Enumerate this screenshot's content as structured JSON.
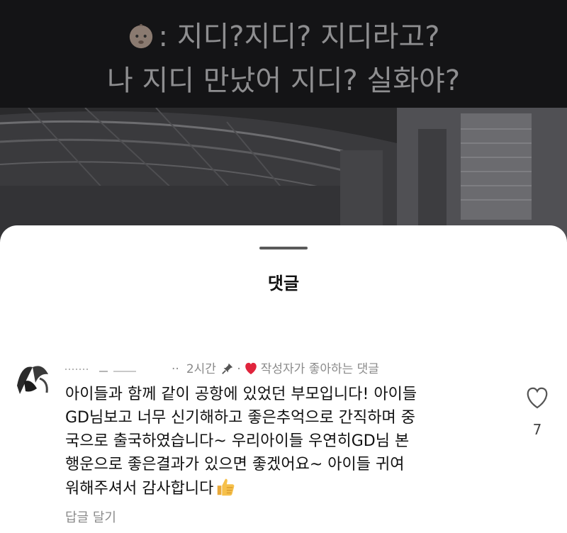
{
  "video": {
    "caption_line1": ": 지디?지디? 지디라고?",
    "caption_line2": "나 지디 만났어 지디? 실화야?",
    "caption_emoji": "baby-face-icon"
  },
  "sheet": {
    "title": "댓글"
  },
  "comment": {
    "time": "2시간",
    "creator_liked": "작성자가 좋아하는 댓글",
    "lines": [
      "아이들과 함께 같이 공항에 있었던 부모입니다! 아이들",
      "GD님보고 너무 신기해하고 좋은추억으로 간직하며 중",
      "국으로 출국하였습니다~ 우리아이들 우연히GD님 본",
      "행운으로 좋은결과가 있으면 좋겠어요~ 아이들 귀여",
      "워해주셔서 감사합니다"
    ],
    "like_count": "7",
    "reply_label": "답글 달기",
    "icons": {
      "pin": "pin-icon",
      "heart": "heart-icon",
      "thumb": "thumbs-up-icon"
    }
  },
  "colors": {
    "heart": "#e0243c",
    "muted_text": "#8a8a8a",
    "caption": "#8e8e90"
  }
}
